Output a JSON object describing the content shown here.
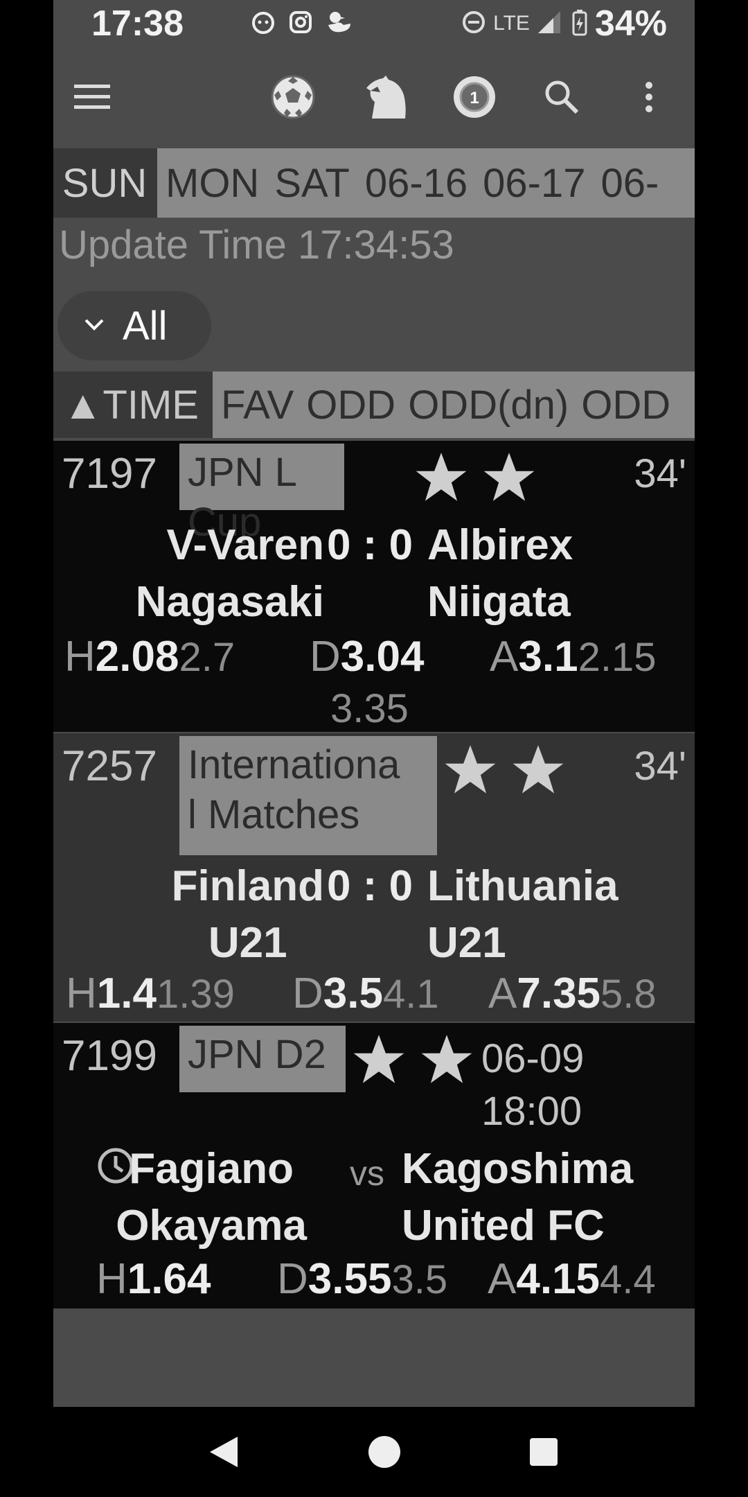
{
  "status_bar": {
    "time": "17:38",
    "network": "LTE",
    "battery": "34%",
    "icons": [
      "cat-face-icon",
      "instagram-icon",
      "duck-icon",
      "do-not-disturb-icon",
      "signal-icon",
      "battery-charging-icon"
    ]
  },
  "toolbar": {
    "icons": [
      "menu-icon",
      "soccer-ball-icon",
      "horse-icon",
      "lottery-ball-icon",
      "search-icon",
      "more-vert-icon"
    ]
  },
  "day_tabs": {
    "selected": "SUN",
    "others": [
      "MON",
      "SAT",
      "06-16",
      "06-17",
      "06-"
    ]
  },
  "update_time": "Update Time 17:34:53",
  "filter": {
    "label": "All"
  },
  "sort_bar": {
    "selected": "▲TIME",
    "others": [
      "FAV",
      "ODD",
      "ODD(dn)",
      "ODD"
    ]
  },
  "matches": [
    {
      "number": "7197",
      "league": "JPN L Cup",
      "status": "34'",
      "home_line1": "V-Varen",
      "home_line2": "Nagasaki",
      "score": "0 : 0",
      "away_line1": "Albirex",
      "away_line2": "Niigata",
      "odds": {
        "h_label": "H",
        "h": "2.08",
        "h_prev": "2.7",
        "d_label": "D",
        "d": "3.04",
        "d_prev": "3.35",
        "a_label": "A",
        "a": "3.1",
        "a_prev": "2.15"
      }
    },
    {
      "number": "7257",
      "league_line1": "Internationa",
      "league_line2": "l Matches",
      "status": "34'",
      "home_line1": "Finland",
      "home_line2": "U21",
      "score": "0 : 0",
      "away_line1": "Lithuania",
      "away_line2": "U21",
      "odds": {
        "h_label": "H",
        "h": "1.4",
        "h_prev": "1.39",
        "d_label": "D",
        "d": "3.5",
        "d_prev": "4.1",
        "a_label": "A",
        "a": "7.35",
        "a_prev": "5.8"
      }
    },
    {
      "number": "7199",
      "league": "JPN D2",
      "kickoff_date": "06-09",
      "kickoff_time": "18:00",
      "home_line1": "Fagiano",
      "home_line2": "Okayama",
      "vs": "vs",
      "away_line1": "Kagoshima",
      "away_line2": "United FC",
      "odds": {
        "h_label": "H",
        "h": "1.64",
        "h_prev": "",
        "d_label": "D",
        "d": "3.55",
        "d_prev": "3.5",
        "a_label": "A",
        "a": "4.15",
        "a_prev": "4.4"
      }
    }
  ],
  "nav": {
    "icons": [
      "back-icon",
      "home-icon",
      "recents-icon"
    ]
  }
}
